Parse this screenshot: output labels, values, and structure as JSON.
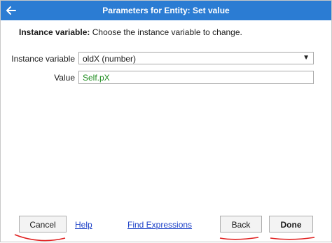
{
  "dialog": {
    "title": "Parameters for Entity: Set value",
    "back_icon": "arrow-left-icon"
  },
  "description": {
    "label": "Instance variable:",
    "text": " Choose the instance variable to change."
  },
  "fields": {
    "instance_variable": {
      "label": "Instance variable",
      "value": "oldX (number)"
    },
    "value": {
      "label": "Value",
      "value": "Self.pX"
    }
  },
  "footer": {
    "cancel_label": "Cancel",
    "help_label": "Help",
    "find_expressions_label": "Find Expressions",
    "back_label": "Back",
    "done_label": "Done"
  },
  "colors": {
    "titlebar": "#2b7cd3",
    "value_text": "#1e8c1e",
    "link": "#1f43c8",
    "annotation": "#e02020"
  }
}
